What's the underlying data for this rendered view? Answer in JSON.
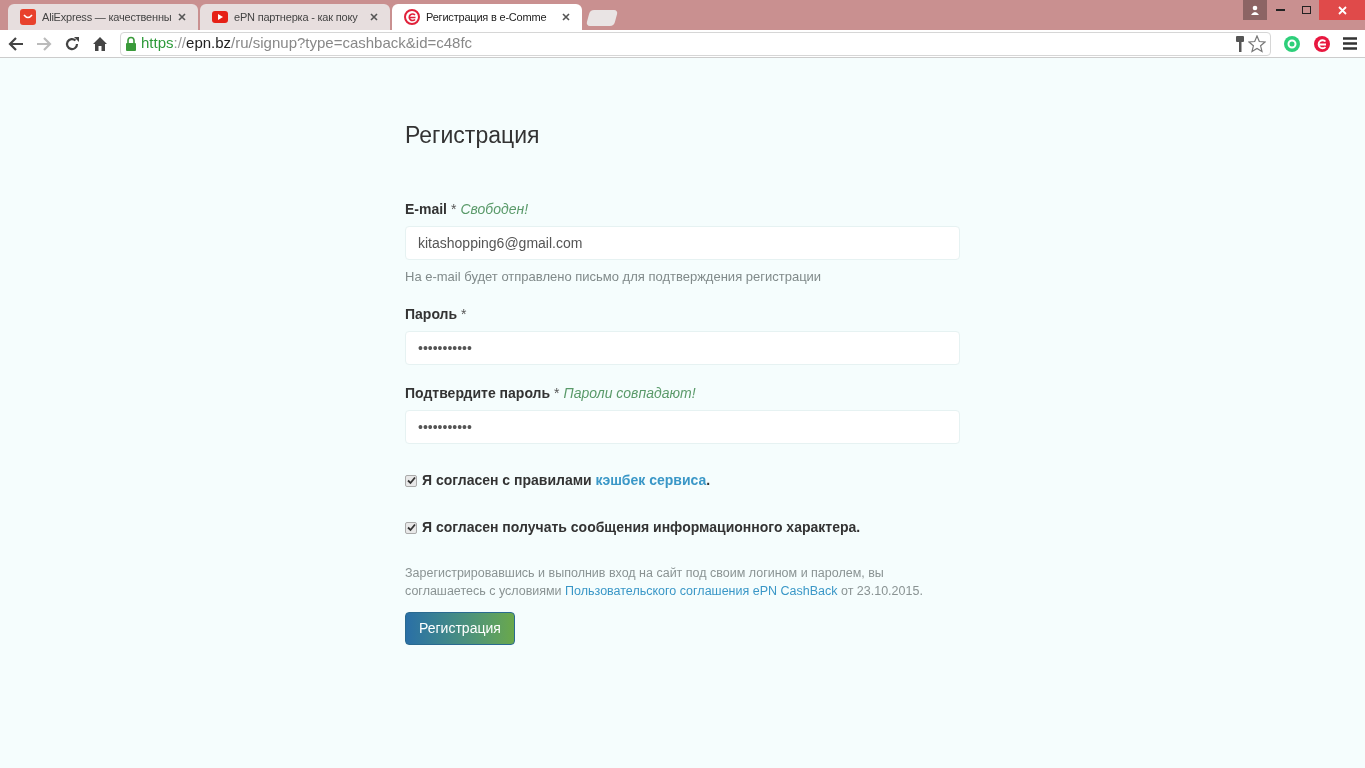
{
  "tabs": [
    {
      "kind": "bag",
      "title": "AliExpress — качественны",
      "selected": false
    },
    {
      "kind": "video",
      "title": "ePN партнерка - как поку",
      "selected": false
    },
    {
      "kind": "e-logo",
      "title": "Регистрация в e-Comme",
      "selected": true
    }
  ],
  "address": {
    "scheme": "https",
    "separator": "://",
    "host": "epn.bz",
    "path": "/ru/signup?type=cashback&id=c48fc"
  },
  "form": {
    "title": "Регистрация",
    "fields": [
      {
        "label": "E-mail",
        "required": "*",
        "status": "Свободен!",
        "value": "kitashopping6@gmail.com",
        "help": "На e-mail будет отправлено письмо для подтверждения регистрации"
      },
      {
        "label": "Пароль",
        "required": "*",
        "value": "•••••••••••"
      },
      {
        "label": "Подтвердите пароль",
        "required": "*",
        "status": "Пароли совпадают!",
        "value": "•••••••••••"
      }
    ],
    "agreements": [
      {
        "text": "Я согласен с правилами",
        "link": "кэшбек сервиса",
        "after": ".",
        "checked": true
      },
      {
        "text": "Я согласен получать сообщения информационного характера.",
        "checked": true
      }
    ],
    "note": {
      "before": "Зарегистрировавшись и выполнив вход на сайт под своим логином и паролем, вы соглашаетесь с условиями",
      "link": "Пользовательского соглашения ePN CashBack",
      "after": "от 23.10.2015."
    },
    "submit": "Регистрация"
  }
}
